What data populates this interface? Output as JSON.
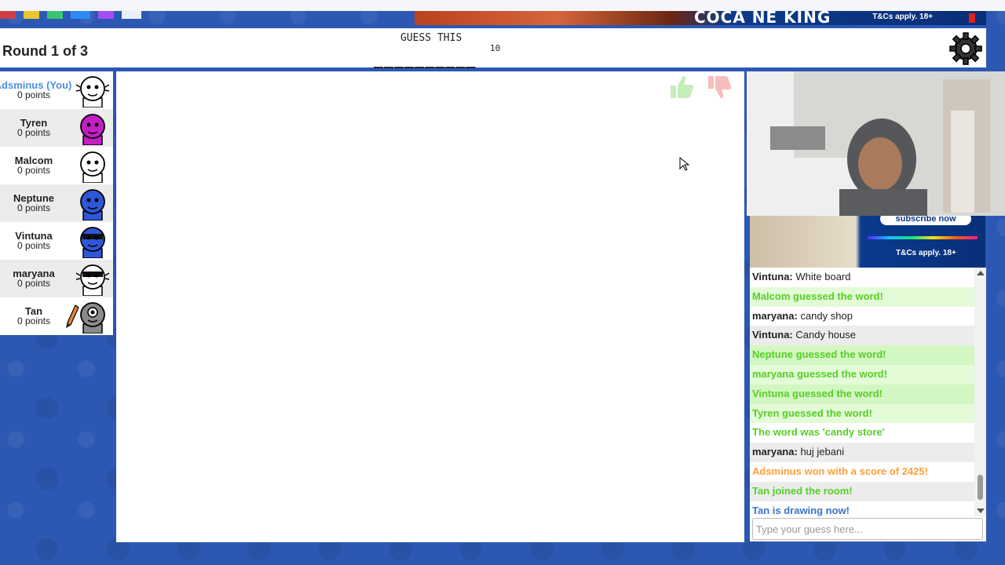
{
  "ad_top": {
    "headline": "COCA NE KING",
    "terms": "T&Cs apply. 18+"
  },
  "header": {
    "round": "Round 1 of 3",
    "guess_label": "GUESS THIS",
    "word_blanks": "__________",
    "word_length": "10"
  },
  "players": [
    {
      "name": "Adsminus (You)",
      "points": "0 points",
      "avatar": "white-cat-avatar",
      "color": "#ffffff",
      "you": true
    },
    {
      "name": "Tyren",
      "points": "0 points",
      "avatar": "purple-face-avatar",
      "color": "#c41ec4"
    },
    {
      "name": "Malcom",
      "points": "0 points",
      "avatar": "white-face-avatar",
      "color": "#ffffff"
    },
    {
      "name": "Neptune",
      "points": "0 points",
      "avatar": "blue-face-avatar",
      "color": "#2f55d8"
    },
    {
      "name": "Vintuna",
      "points": "0 points",
      "avatar": "blue-masked-avatar",
      "color": "#2f55d8"
    },
    {
      "name": "maryana",
      "points": "0 points",
      "avatar": "white-masked-cat-avatar",
      "color": "#ffffff"
    },
    {
      "name": "Tan",
      "points": "0 points",
      "avatar": "gray-cyclops-avatar",
      "color": "#8a8a8a",
      "drawing": true
    }
  ],
  "chat_ad": {
    "button": "subscribe now",
    "terms": "T&Cs apply. 18+"
  },
  "chat": {
    "messages": [
      {
        "who": "Vintuna:",
        "text": "White board",
        "type": "user"
      },
      {
        "who": "",
        "text": "Malcom guessed the word!",
        "type": "guessed"
      },
      {
        "who": "maryana:",
        "text": "candy shop",
        "type": "user"
      },
      {
        "who": "Vintuna:",
        "text": "Candy house",
        "type": "user"
      },
      {
        "who": "",
        "text": "Neptune guessed the word!",
        "type": "guessed"
      },
      {
        "who": "",
        "text": "maryana guessed the word!",
        "type": "guessed"
      },
      {
        "who": "",
        "text": "Vintuna guessed the word!",
        "type": "guessed"
      },
      {
        "who": "",
        "text": "Tyren guessed the word!",
        "type": "guessed"
      },
      {
        "who": "",
        "text": "The word was 'candy store'",
        "type": "sys-green"
      },
      {
        "who": "maryana:",
        "text": "huj jebani",
        "type": "user"
      },
      {
        "who": "",
        "text": "Adsminus won with a score of 2425!",
        "type": "sys-orange"
      },
      {
        "who": "",
        "text": "Tan joined the room!",
        "type": "sys-green"
      },
      {
        "who": "",
        "text": "Tan is drawing now!",
        "type": "sys-blue"
      }
    ],
    "input_placeholder": "Type your guess here..."
  },
  "colors": {
    "background": "#2c58b4",
    "guessed_text": "#56ce27",
    "guessed_bg": "#e3fbd6",
    "won_text": "#ff9f3a",
    "drawing_text": "#3975ce",
    "you_text": "#4a90e2"
  }
}
